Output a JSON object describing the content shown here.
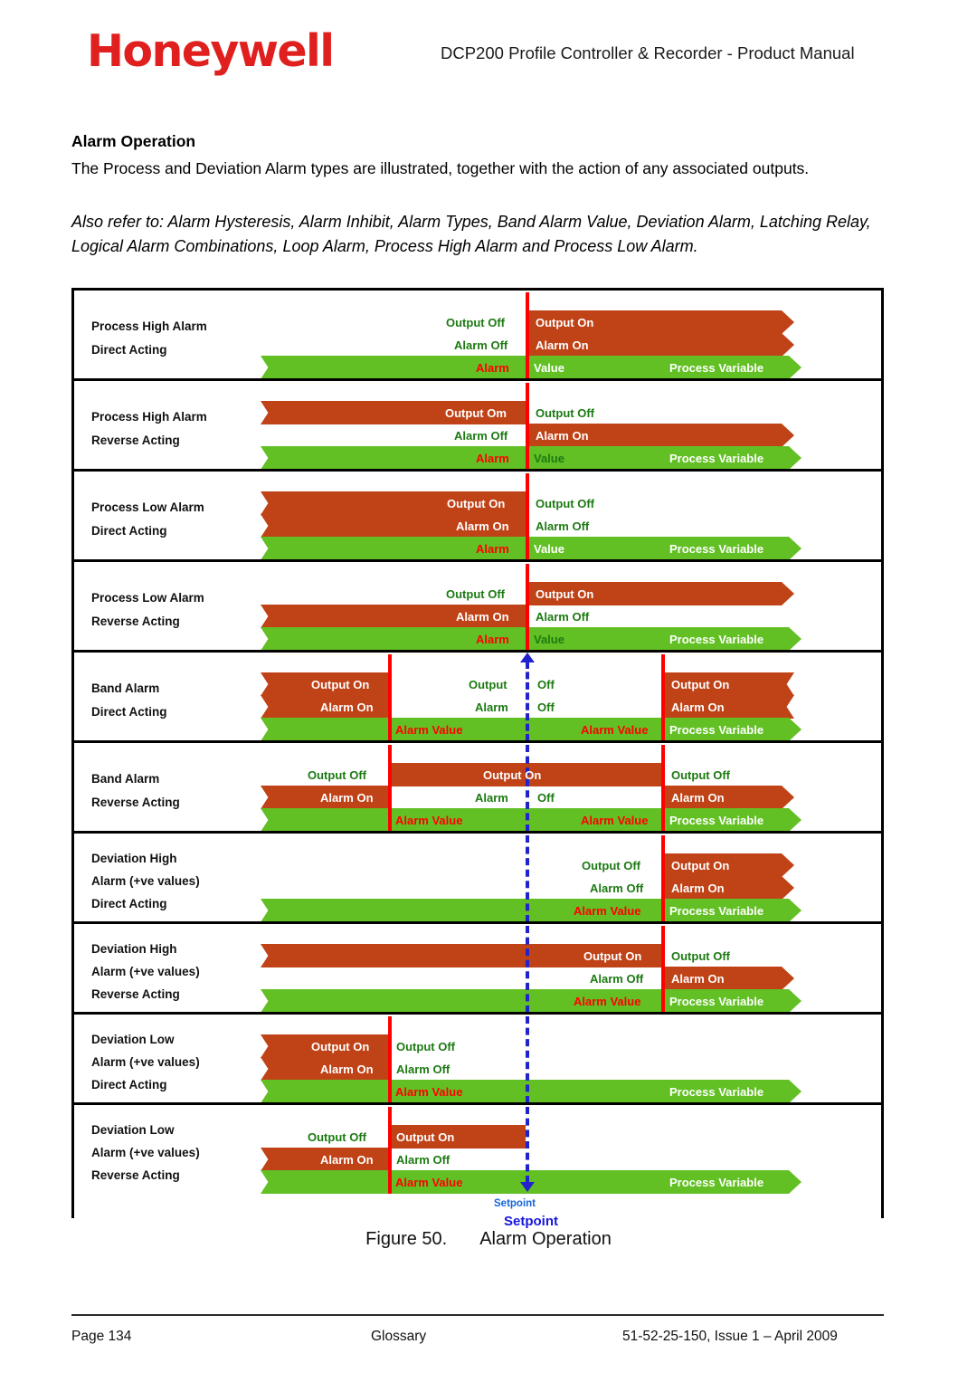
{
  "header": {
    "logo": "Honeywell",
    "title": "DCP200 Profile Controller & Recorder - Product Manual"
  },
  "section": {
    "heading": "Alarm Operation",
    "paragraph": "The Process and Deviation Alarm types are illustrated, together with the action of any associated outputs.",
    "also_refer": "Also refer to: Alarm Hysteresis, Alarm Inhibit, Alarm Types, Band Alarm Value, Deviation Alarm, Latching Relay, Logical Alarm Combinations, Loop Alarm, Process High Alarm and Process Low Alarm."
  },
  "figure": {
    "number": "Figure 50.",
    "caption": "Alarm Operation",
    "setpoint_inner_label": "Setpoint",
    "setpoint_outer_label": "Setpoint",
    "colors": {
      "alarm_on_bar": "#C04318",
      "process_variable_bar": "#62C024",
      "alarm_value_line": "#FF0000",
      "setpoint_line": "#2222CC",
      "off_text": "#1C7A12"
    },
    "common": {
      "process_variable": "Process Variable",
      "alarm_value": "Alarm Value",
      "alarm_word": "Alarm",
      "value_word": "Value",
      "output_word": "Output",
      "output_on": "Output On",
      "output_off": "Output Off",
      "alarm_on": "Alarm On",
      "alarm_off": "Alarm Off",
      "off_word": "Off"
    },
    "rows": [
      {
        "id": "process-high-direct",
        "title": "Process High Alarm",
        "action": "Direct Acting",
        "output_left": "Output Off",
        "output_right": "Output On",
        "alarm_left": "Alarm Off",
        "alarm_right": "Alarm On",
        "scale_left": "Alarm",
        "scale_right": "Value",
        "pv": "Process Variable"
      },
      {
        "id": "process-high-reverse",
        "title": "Process High Alarm",
        "action": "Reverse Acting",
        "output_left": "Output Om",
        "output_right": "Output Off",
        "alarm_left": "Alarm Off",
        "alarm_right": "Alarm On",
        "scale_left": "Alarm",
        "scale_right": "Value",
        "pv": "Process Variable"
      },
      {
        "id": "process-low-direct",
        "title": "Process Low Alarm",
        "action": "Direct Acting",
        "output_left": "Output On",
        "output_right": "Output Off",
        "alarm_left": "Alarm On",
        "alarm_right": "Alarm Off",
        "scale_left": "Alarm",
        "scale_right": "Value",
        "pv": "Process Variable"
      },
      {
        "id": "process-low-reverse",
        "title": "Process Low Alarm",
        "action": "Reverse Acting",
        "output_left": "Output Off",
        "output_right": "Output On",
        "alarm_left": "Alarm On",
        "alarm_right": "Alarm Off",
        "scale_left": "Alarm",
        "scale_right": "Value",
        "pv": "Process Variable"
      },
      {
        "id": "band-alarm-direct",
        "title": "Band Alarm",
        "action": "Direct Acting",
        "output_left": "Output On",
        "output_mid_a": "Output",
        "output_mid_b": "Off",
        "output_right": "Output On",
        "alarm_left": "Alarm On",
        "alarm_mid_a": "Alarm",
        "alarm_mid_b": "Off",
        "alarm_right": "Alarm On",
        "alarm_value_left": "Alarm Value",
        "alarm_value_right": "Alarm Value",
        "pv": "Process Variable"
      },
      {
        "id": "band-alarm-reverse",
        "title": "Band Alarm",
        "action": "Reverse Acting",
        "output_left": "Output Off",
        "output_mid": "Output On",
        "output_right": "Output Off",
        "alarm_left": "Alarm On",
        "alarm_mid_a": "Alarm",
        "alarm_mid_b": "Off",
        "alarm_right": "Alarm On",
        "alarm_value_left": "Alarm Value",
        "alarm_value_right": "Alarm Value",
        "pv": "Process Variable"
      },
      {
        "id": "deviation-high-direct",
        "title": "Deviation High",
        "subtitle": "Alarm (+ve values)",
        "action": "Direct Acting",
        "output_left": "Output Off",
        "output_right": "Output On",
        "alarm_left": "Alarm Off",
        "alarm_right": "Alarm On",
        "alarm_value": "Alarm Value",
        "pv": "Process Variable"
      },
      {
        "id": "deviation-high-reverse",
        "title": "Deviation High",
        "subtitle": "Alarm (+ve values)",
        "action": "Reverse Acting",
        "output_left": "Output On",
        "output_right": "Output Off",
        "alarm_left": "Alarm Off",
        "alarm_right": "Alarm On",
        "alarm_value": "Alarm Value",
        "pv": "Process Variable"
      },
      {
        "id": "deviation-low-direct",
        "title": "Deviation Low",
        "subtitle": "Alarm (+ve values)",
        "action": "Direct Acting",
        "output_left": "Output On",
        "output_right": "Output Off",
        "alarm_left": "Alarm On",
        "alarm_right": "Alarm Off",
        "alarm_value": "Alarm Value",
        "pv": "Process Variable"
      },
      {
        "id": "deviation-low-reverse",
        "title": "Deviation Low",
        "subtitle": "Alarm (+ve values)",
        "action": "Reverse Acting",
        "output_left": "Output Off",
        "output_right": "Output On",
        "alarm_left": "Alarm On",
        "alarm_right": "Alarm Off",
        "alarm_value": "Alarm Value",
        "pv": "Process Variable"
      }
    ]
  },
  "footer": {
    "page": "Page 134",
    "section": "Glossary",
    "doc": "51-52-25-150, Issue 1 – April 2009"
  }
}
